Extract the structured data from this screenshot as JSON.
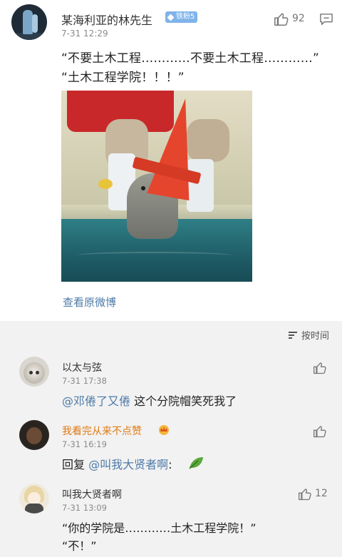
{
  "post": {
    "author": "某海利亚的林先生",
    "fan_badge": "铁粉5",
    "time": "7-31 12:29",
    "like_count": "92",
    "text_line1": "“不要土木工程…………不要土木工程…………”",
    "text_line2": "“土木工程学院！！！”",
    "view_original": "查看原微博"
  },
  "comments_header": {
    "sort_label": "按时间"
  },
  "comments": [
    {
      "name": "以太与弦",
      "time": "7-31 17:38",
      "mention": "@邓倦了又倦",
      "text": " 这个分院帽笑死我了"
    },
    {
      "name": "我看完从来不点赞",
      "time": "7-31 16:19",
      "reply_prefix": "回复 ",
      "mention": "@叫我大贤者啊",
      "text": ":"
    },
    {
      "name": "叫我大贤者啊",
      "time": "7-31 13:09",
      "like_count": "12",
      "text_line1": "“你的学院是…………土木工程学院！”",
      "text_line2": "“不！”"
    }
  ],
  "colors": {
    "link": "#4d7aa8",
    "badge": "#7fb3ea",
    "vip_name": "#e07a14"
  },
  "icons": [
    "thumbs-up-icon",
    "comment-icon",
    "sort-icon",
    "crown-icon",
    "leaf-emoji-icon"
  ]
}
